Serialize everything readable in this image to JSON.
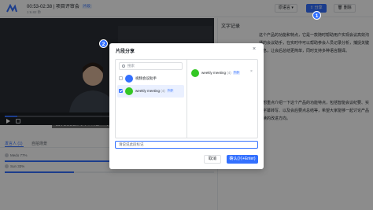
{
  "header": {
    "title": "00:53-02:38 | 项目评审会",
    "title_tag": "片段",
    "subtitle": "1:6.82 秒",
    "language_label": "原语言",
    "share_label": "分享",
    "delete_label": "删除"
  },
  "callouts": [
    "1",
    "2"
  ],
  "video": {
    "caption": "首先我想简单介绍一下",
    "progress_fraction": 0.06
  },
  "tabs": [
    "发言人 (1)",
    "自拍场景"
  ],
  "speakers": [
    {
      "label": "Medo 77%",
      "fraction": 0.77
    },
    {
      "label": "Sun 33%",
      "fraction": 0.33
    }
  ],
  "transcript": {
    "title": "文字记录",
    "paragraphs": [
      "这个产品的功能和特点，它是一款随时帮助用户实现会议高效沟通的会议助手，在实时中可以帮助参会人员记录分析，捕捉关键信息，让会后总结更简单，同时支持多种语言翻译。",
      "我想重点介绍一下这个产品的功能特点，包括智能会议纪要、实时字幕转写、以及会后要点总结等，希望大家能够一起讨论产品后续的改进方向。"
    ]
  },
  "dialog": {
    "title": "片段分享",
    "close_symbol": "×",
    "search_placeholder": "搜索",
    "items": [
      {
        "label": "视频会议助手",
        "count": "",
        "badge": "",
        "checked": false,
        "avatar_color": "#3370ff"
      },
      {
        "label": "weekly meeting",
        "count": "(4)",
        "badge": "外部",
        "checked": true,
        "avatar_color": "#34c724"
      }
    ],
    "selected": {
      "label": "weekly meeting",
      "count": "(4)",
      "badge": "外部",
      "remove_symbol": "×"
    },
    "note_placeholder": "请说说此段标记",
    "cancel_label": "取消",
    "confirm_label": "确认(⌘+Enter)"
  },
  "colors": {
    "accent": "#3370ff",
    "group_green": "#34c724"
  }
}
